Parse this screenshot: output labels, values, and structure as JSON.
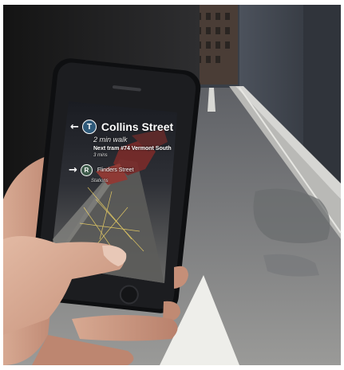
{
  "ar": {
    "primary": {
      "arrow": "←",
      "badge": "T",
      "street": "Collins Street",
      "walk": "2 min walk",
      "route": "Next tram #74 Vermont South",
      "time": "3 mins"
    },
    "secondary": {
      "arrow": "→",
      "badge": "R",
      "street": "Flinders Street",
      "sub": "Stations"
    }
  },
  "colors": {
    "badge_tram": "#2f5a7a",
    "road": "#8a8a88",
    "sky": "#2a2f36"
  },
  "icons": [
    "left-arrow-icon",
    "tram-badge-icon",
    "right-arrow-icon",
    "rail-badge-icon"
  ]
}
